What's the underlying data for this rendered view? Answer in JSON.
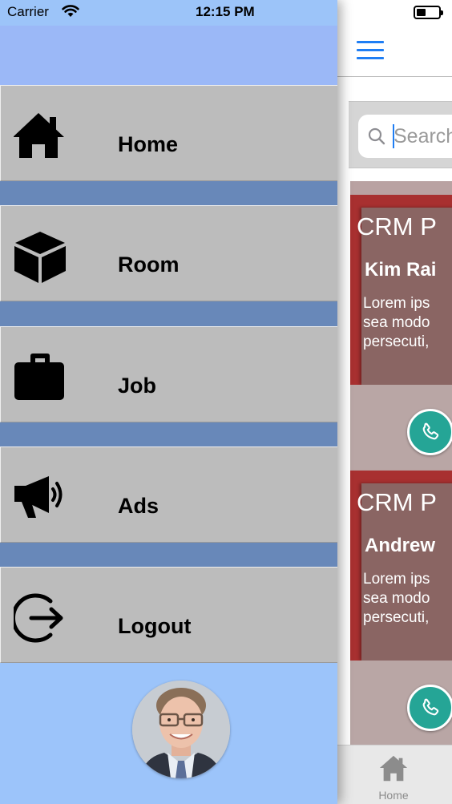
{
  "status_bar": {
    "carrier": "Carrier",
    "time": "12:15 PM"
  },
  "drawer": {
    "menu_items": [
      {
        "label": "Home",
        "icon": "home-icon"
      },
      {
        "label": "Room",
        "icon": "cube-icon"
      },
      {
        "label": "Job",
        "icon": "briefcase-icon"
      },
      {
        "label": "Ads",
        "icon": "megaphone-icon"
      },
      {
        "label": "Logout",
        "icon": "logout-icon"
      }
    ],
    "profile": {
      "icon": "profile-avatar"
    }
  },
  "main": {
    "search": {
      "placeholder": "Search"
    },
    "cards": [
      {
        "title": "CRM P",
        "name": "Kim Rai",
        "description": "Lorem ips\nsea modo\npersecuti,"
      },
      {
        "title": "CRM P",
        "name": "Andrew",
        "description": "Lorem ips\nsea modo\npersecuti,"
      }
    ],
    "tab_bar": {
      "tabs": [
        {
          "label": "Home",
          "icon": "home-icon"
        }
      ]
    }
  },
  "colors": {
    "drawer_top": "#9bb8f7",
    "menu_item_bg": "#bcbcbc",
    "menu_gap": "#6888b9",
    "accent": "#1f7ef4",
    "card_red": "#a83030",
    "call_button": "#25a596"
  }
}
